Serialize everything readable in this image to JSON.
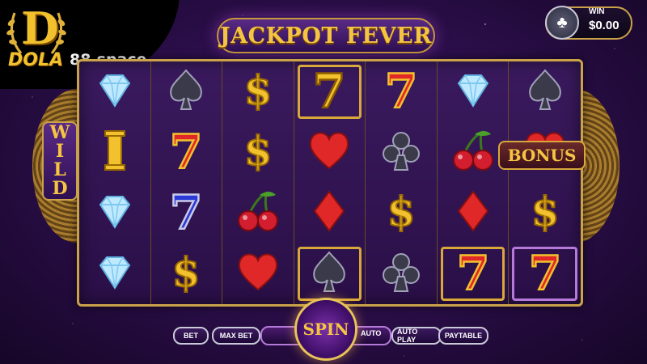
{
  "logo": {
    "letter": "D",
    "brand": "DOLA",
    "domain": "88.space"
  },
  "title": "JACKPOT FEVER",
  "win": {
    "label": "WIN",
    "value": "$0.00",
    "icon": "club-icon"
  },
  "wild_label": [
    "W",
    "I",
    "L",
    "D"
  ],
  "bonus_label": "BONUS",
  "reels": [
    [
      "diamond",
      "bar",
      "diamond",
      "diamond"
    ],
    [
      "spade",
      "seven-red",
      "seven-blue",
      "dollar"
    ],
    [
      "dollar",
      "dollar",
      "cherry",
      "heart"
    ],
    [
      "seven-gold",
      "heart",
      "diamond-suit",
      "spade"
    ],
    [
      "seven-red",
      "club",
      "dollar",
      "club"
    ],
    [
      "diamond",
      "cherry",
      "diamond-suit",
      "seven-red"
    ],
    [
      "spade",
      "heart",
      "dollar",
      "seven-red"
    ]
  ],
  "framed_cells": [
    {
      "reel": 3,
      "row": 0,
      "style": "gold"
    },
    {
      "reel": 3,
      "row": 3,
      "style": "gold"
    },
    {
      "reel": 5,
      "row": 3,
      "style": "gold"
    },
    {
      "reel": 6,
      "row": 3,
      "style": "purple"
    }
  ],
  "controls": {
    "bet": "BET",
    "max_bet": "MAX BET",
    "spin": "SPIN",
    "auto": "AUTO",
    "auto_play": "AUTO PLAY",
    "paytable": "PAYTABLE"
  },
  "colors": {
    "gold": "#f5c542",
    "purple": "#2d0f4d",
    "red": "#d42a2a"
  }
}
